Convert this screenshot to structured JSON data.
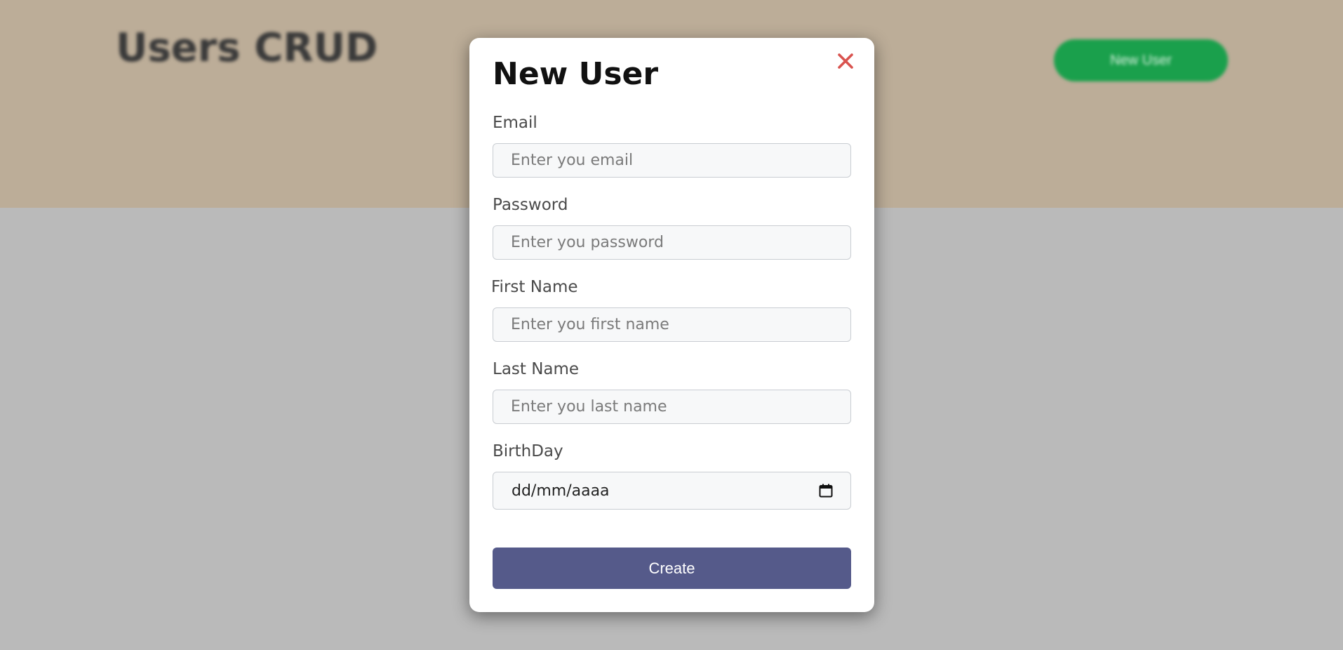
{
  "app": {
    "title": "Users CRUD",
    "new_user_button": "New User"
  },
  "colors": {
    "header_bg": "#bcad98",
    "overlay_bg": "#bababa",
    "new_user_button": "#1aa04c",
    "create_button": "#555a8a",
    "close_icon": "#d9534f"
  },
  "modal": {
    "title": "New User",
    "close_icon": "close-icon",
    "fields": {
      "email": {
        "label": "Email",
        "placeholder": "Enter you email",
        "value": ""
      },
      "password": {
        "label": "Password",
        "placeholder": "Enter you password",
        "value": ""
      },
      "first_name": {
        "label": "First Name",
        "placeholder": "Enter you first name",
        "value": ""
      },
      "last_name": {
        "label": "Last Name",
        "placeholder": "Enter you last name",
        "value": ""
      },
      "birthday": {
        "label": "BirthDay",
        "placeholder": "dd/mm/aaaa",
        "icon": "calendar-icon"
      }
    },
    "submit_label": "Create"
  }
}
